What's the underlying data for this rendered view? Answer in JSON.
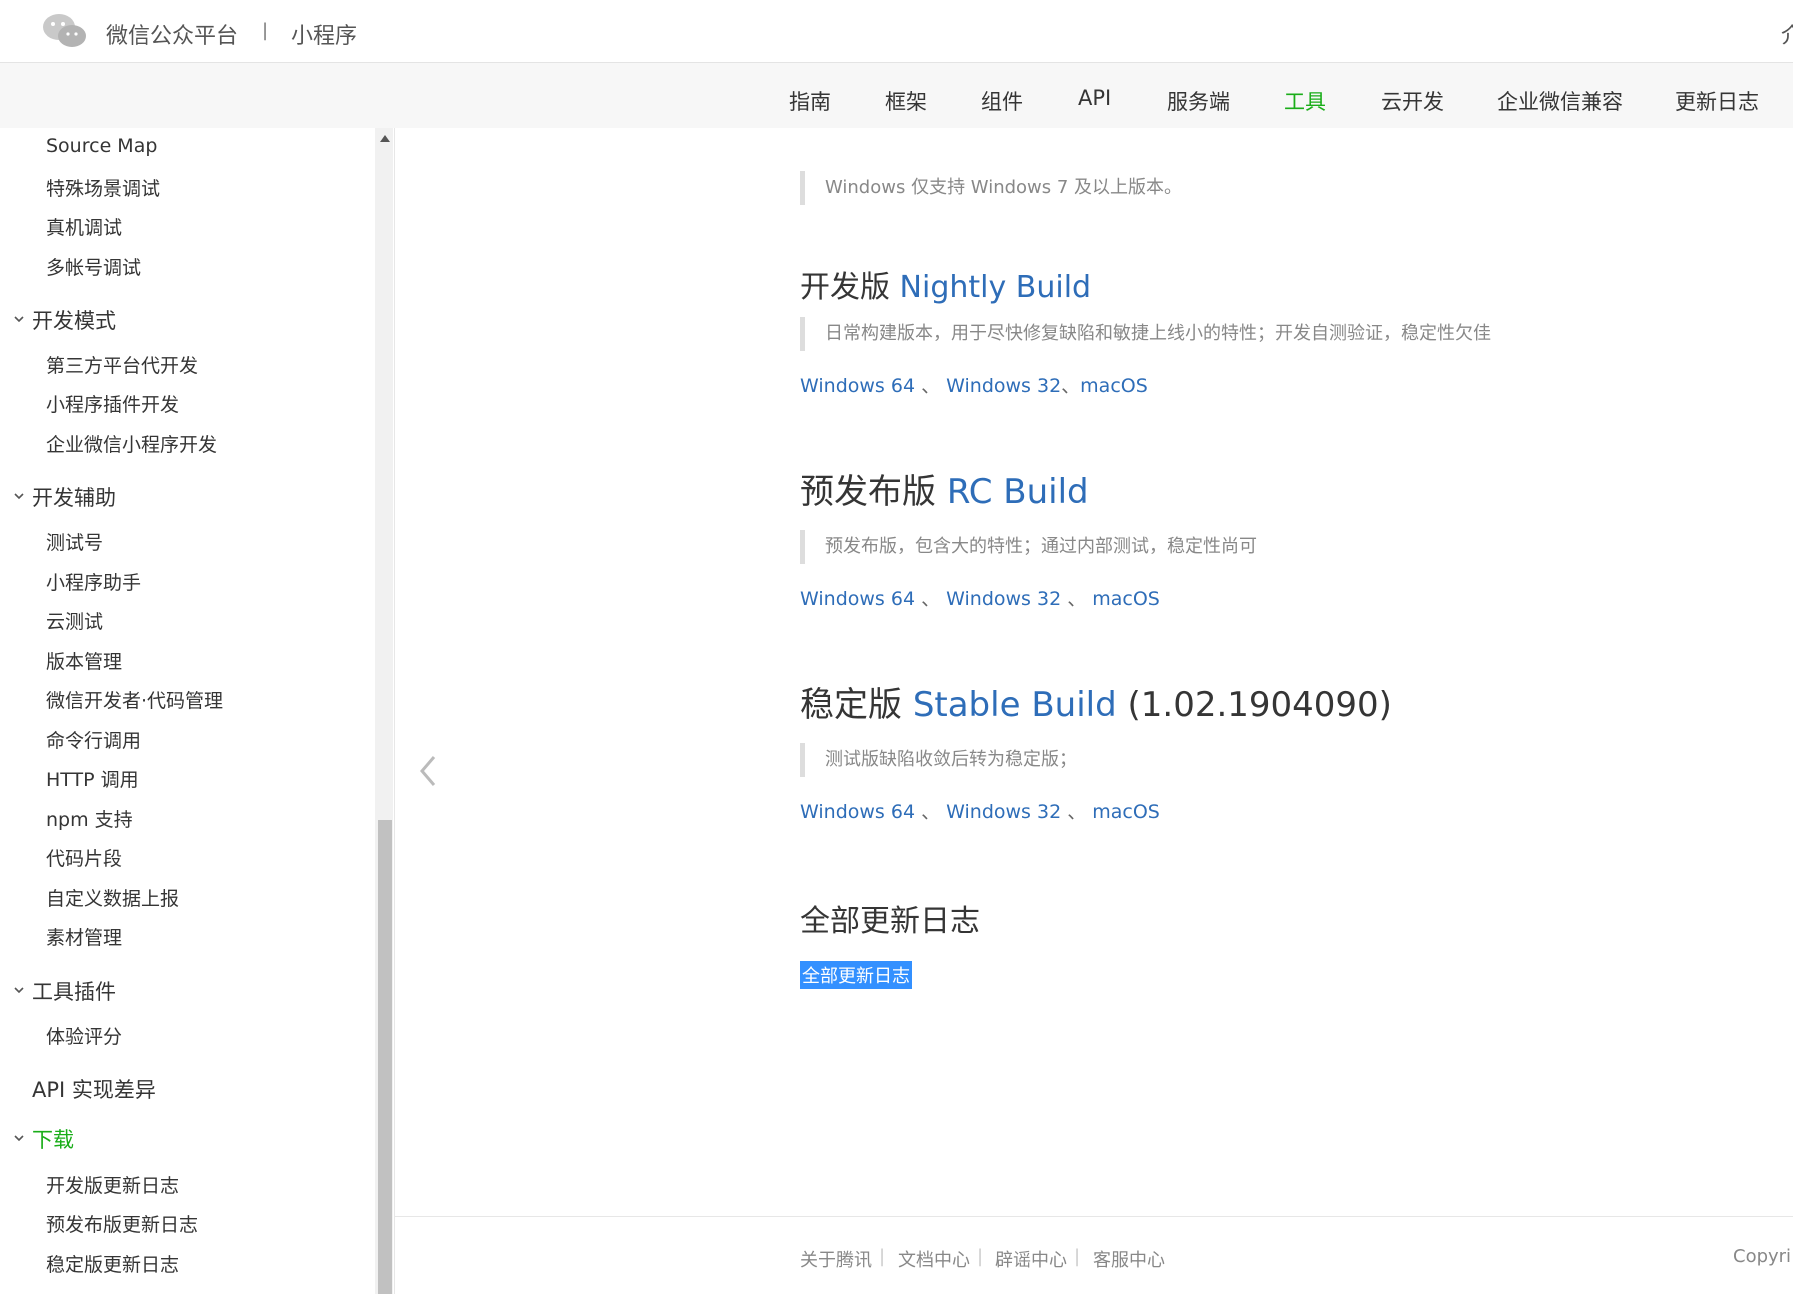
{
  "header": {
    "brand": "微信公众平台",
    "separator": "|",
    "subtitle": "小程序",
    "cut_text": "介"
  },
  "nav": {
    "items": [
      "指南",
      "框架",
      "组件",
      "API",
      "服务端",
      "工具",
      "云开发",
      "企业微信兼容",
      "更新日志"
    ],
    "active": "工具"
  },
  "sidebar": {
    "items": [
      {
        "label": "Source Map"
      },
      {
        "label": "特殊场景调试"
      },
      {
        "label": "真机调试"
      },
      {
        "label": "多帐号调试"
      },
      {
        "label": "开发模式"
      },
      {
        "label": "第三方平台代开发"
      },
      {
        "label": "小程序插件开发"
      },
      {
        "label": "企业微信小程序开发"
      },
      {
        "label": "开发辅助"
      },
      {
        "label": "测试号"
      },
      {
        "label": "小程序助手"
      },
      {
        "label": "云测试"
      },
      {
        "label": "版本管理"
      },
      {
        "label": "微信开发者·代码管理"
      },
      {
        "label": "命令行调用"
      },
      {
        "label": "HTTP 调用"
      },
      {
        "label": "npm 支持"
      },
      {
        "label": "代码片段"
      },
      {
        "label": "自定义数据上报"
      },
      {
        "label": "素材管理"
      },
      {
        "label": "工具插件"
      },
      {
        "label": "体验评分"
      },
      {
        "label": "API 实现差异"
      },
      {
        "label": "下载"
      },
      {
        "label": "开发版更新日志"
      },
      {
        "label": "预发布版更新日志"
      },
      {
        "label": "稳定版更新日志"
      }
    ]
  },
  "content": {
    "top_note": "Windows 仅支持 Windows 7 及以上版本。",
    "nightly": {
      "title_cn": "开发版",
      "title_en": "Nightly Build",
      "desc": "日常构建版本，用于尽快修复缺陷和敏捷上线小的特性；开发自测验证，稳定性欠佳",
      "win64": "Windows 64",
      "sep1": " 、 ",
      "win32": "Windows 32",
      "sep2": "、",
      "mac": "macOS"
    },
    "rc": {
      "title_cn": "预发布版",
      "title_en": "RC Build",
      "desc": "预发布版，包含大的特性；通过内部测试，稳定性尚可",
      "win64": "Windows 64",
      "sep1": " 、 ",
      "win32": "Windows 32",
      "sep2": " 、 ",
      "mac": "macOS"
    },
    "stable": {
      "title_cn": "稳定版",
      "title_en": "Stable Build",
      "version": "(1.02.1904090)",
      "desc": "测试版缺陷收敛后转为稳定版；",
      "win64": "Windows 64",
      "sep1": " 、 ",
      "win32": "Windows 32",
      "sep2": " 、 ",
      "mac": "macOS"
    },
    "all_log": {
      "title": "全部更新日志",
      "link": "全部更新日志"
    }
  },
  "footer": {
    "links": [
      "关于腾讯",
      "文档中心",
      "辟谣中心",
      "客服中心"
    ],
    "separator": "|",
    "copyright_cut": "Copyri"
  },
  "colors": {
    "accent_green": "#1aad19",
    "link_blue": "#2e6db8",
    "selection_blue": "#3390ff"
  }
}
